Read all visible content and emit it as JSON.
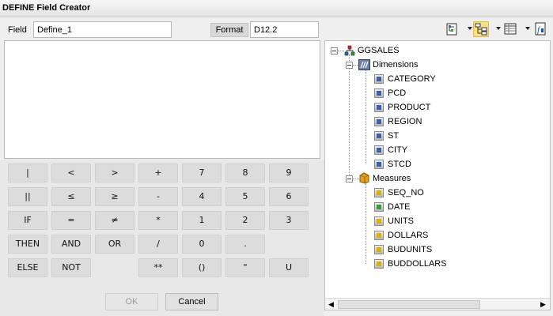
{
  "window": {
    "title": "DEFINE Field Creator"
  },
  "field": {
    "label": "Field",
    "value": "Define_1"
  },
  "format": {
    "label": "Format",
    "value": "D12.2"
  },
  "expression": {
    "value": ""
  },
  "keypad": {
    "rows": [
      [
        "|",
        "<",
        ">",
        "+",
        "7",
        "8",
        "9"
      ],
      [
        "||",
        "≤",
        "≥",
        "-",
        "4",
        "5",
        "6"
      ],
      [
        "IF",
        "=",
        "≠",
        "*",
        "1",
        "2",
        "3"
      ],
      [
        "THEN",
        "AND",
        "OR",
        "/",
        "0",
        ".",
        ""
      ],
      [
        "ELSE",
        "NOT",
        "",
        "**",
        "()",
        "\"",
        "U"
      ]
    ]
  },
  "buttons": {
    "ok": "OK",
    "cancel": "Cancel"
  },
  "tree": {
    "root": "GGSALES",
    "dimensions": {
      "label": "Dimensions",
      "items": [
        "CATEGORY",
        "PCD",
        "PRODUCT",
        "REGION",
        "ST",
        "CITY",
        "STCD"
      ]
    },
    "measures": {
      "label": "Measures",
      "items": [
        "SEQ_NO",
        "DATE",
        "UNITS",
        "DOLLARS",
        "BUDUNITS",
        "BUDDOLLARS"
      ]
    }
  },
  "icons": {
    "toolbar": [
      "tree-view-icon",
      "hierarchy-view-icon",
      "list-view-icon",
      "function-icon"
    ],
    "root": "data-source-icon",
    "dimensions": "dimension-group-icon",
    "measures": "measure-group-icon"
  },
  "colors": {
    "dimension_field": "#3d5fa8",
    "measure_field": "#d8b200",
    "date_field": "#3b9a3b",
    "active_toolbar": "#f7e08a"
  }
}
